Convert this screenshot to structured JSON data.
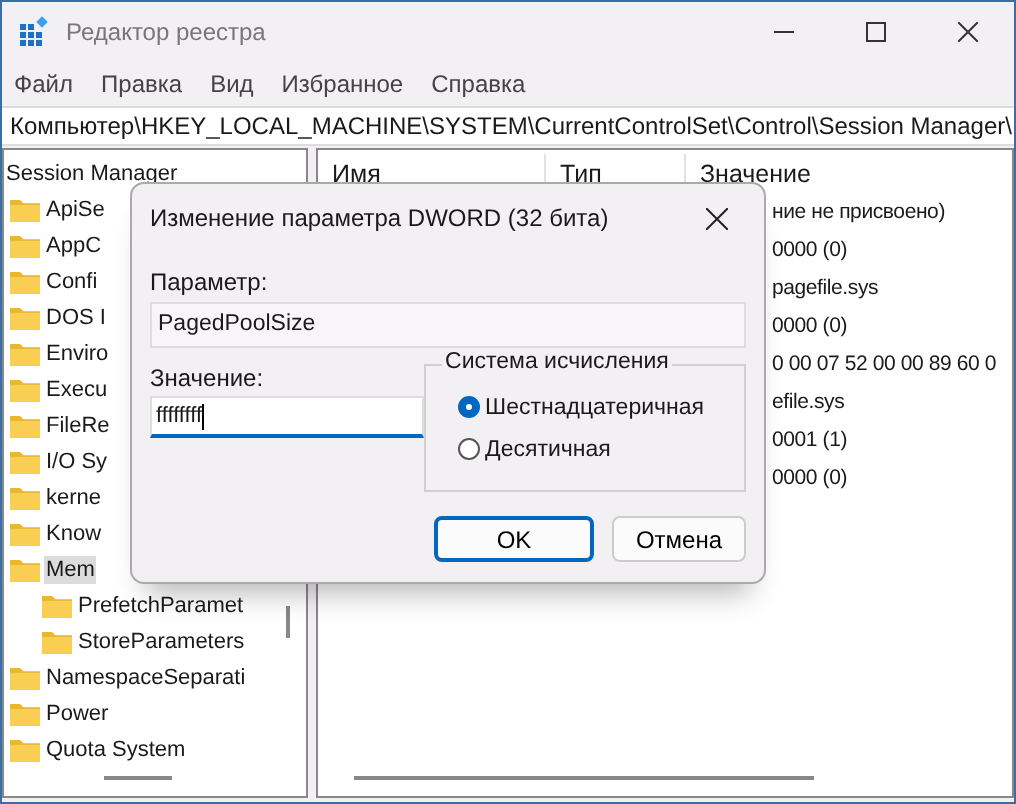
{
  "window": {
    "title": "Редактор реестра"
  },
  "menu": [
    "Файл",
    "Правка",
    "Вид",
    "Избранное",
    "Справка"
  ],
  "address": "Компьютер\\HKEY_LOCAL_MACHINE\\SYSTEM\\CurrentControlSet\\Control\\Session Manager\\",
  "tree": [
    {
      "label": "Session Manager",
      "selected": false,
      "children": [
        {
          "label": "ApiSe",
          "selected": false
        },
        {
          "label": "AppC",
          "selected": false
        },
        {
          "label": "Confi",
          "selected": false
        },
        {
          "label": "DOS I",
          "selected": false
        },
        {
          "label": "Enviro",
          "selected": false
        },
        {
          "label": "Execu",
          "selected": false
        },
        {
          "label": "FileRe",
          "selected": false
        },
        {
          "label": "I/O Sy",
          "selected": false
        },
        {
          "label": "kerne",
          "selected": false
        },
        {
          "label": "Know",
          "selected": false
        },
        {
          "label": "Mem",
          "selected": true,
          "children": [
            {
              "label": "PrefetchParamet",
              "selected": false
            },
            {
              "label": "StoreParameters",
              "selected": false
            }
          ]
        },
        {
          "label": "NamespaceSeparati",
          "selected": false
        },
        {
          "label": "Power",
          "selected": false
        },
        {
          "label": "Quota System",
          "selected": false
        }
      ]
    }
  ],
  "values": {
    "columns": [
      "Имя",
      "Тип",
      "Значение"
    ],
    "rows": [
      "ние не присвоено)",
      "0000 (0)",
      "pagefile.sys",
      "0000 (0)",
      "0 00 07 52 00 00 89 60 0",
      "efile.sys",
      "0001 (1)",
      "0000 (0)"
    ]
  },
  "dialog": {
    "title": "Изменение параметра DWORD (32 бита)",
    "name_label": "Параметр:",
    "name_value": "PagedPoolSize",
    "value_label": "Значение:",
    "value": "ffffffff",
    "base_group": "Система исчисления",
    "bases": [
      {
        "label": "Шестнадцатеричная",
        "selected": true
      },
      {
        "label": "Десятичная",
        "selected": false
      }
    ],
    "buttons": [
      {
        "label": "OK",
        "kind": "default"
      },
      {
        "label": "Отмена",
        "kind": "normal"
      }
    ]
  }
}
